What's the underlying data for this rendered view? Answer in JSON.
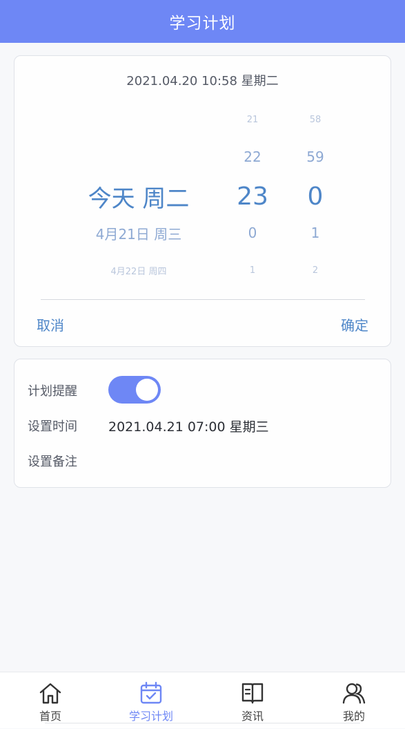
{
  "header": {
    "title": "学习计划"
  },
  "picker": {
    "current_datetime": "2021.04.20 10:58 星期二",
    "rows": [
      {
        "day": "",
        "hour": "21",
        "minute": "58"
      },
      {
        "day": "",
        "hour": "22",
        "minute": "59"
      },
      {
        "day": "今天 周二",
        "hour": "23",
        "minute": "0"
      },
      {
        "day": "4月21日 周三",
        "hour": "0",
        "minute": "1"
      },
      {
        "day": "4月22日 周四",
        "hour": "1",
        "minute": "2"
      }
    ],
    "cancel_label": "取消",
    "confirm_label": "确定"
  },
  "settings": {
    "reminder_label": "计划提醒",
    "reminder_enabled": true,
    "time_label": "设置时间",
    "time_value": "2021.04.21 07:00 星期三",
    "note_label": "设置备注"
  },
  "tabbar": {
    "tabs": [
      {
        "label": "首页",
        "icon": "home-icon"
      },
      {
        "label": "学习计划",
        "icon": "calendar-check-icon",
        "active": true
      },
      {
        "label": "资讯",
        "icon": "book-icon"
      },
      {
        "label": "我的",
        "icon": "users-icon"
      }
    ]
  },
  "colors": {
    "accent": "#6e87f5",
    "picker_text": "#4e86c8"
  }
}
